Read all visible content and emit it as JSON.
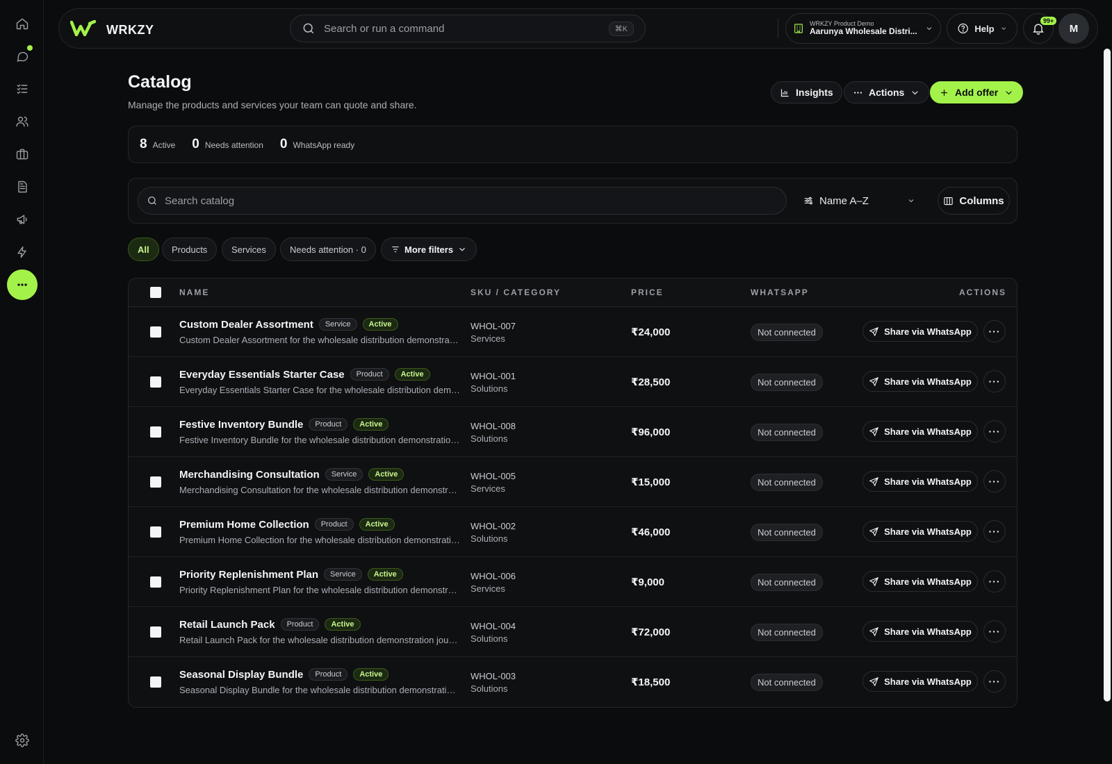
{
  "app": {
    "name": "WRKZY"
  },
  "command_search": {
    "placeholder": "Search or run a command",
    "shortcut": "⌘K"
  },
  "workspace": {
    "label": "WRKZY Product Demo",
    "name": "Aarunya Wholesale Distri..."
  },
  "help": {
    "label": "Help"
  },
  "notifications": {
    "count": "99+"
  },
  "user": {
    "initial": "M"
  },
  "page": {
    "title": "Catalog",
    "subtitle": "Manage the products and services your team can quote and share."
  },
  "header_actions": {
    "insights": "Insights",
    "actions": "Actions",
    "add_offer": "Add offer"
  },
  "stats": [
    {
      "value": "8",
      "label": "Active"
    },
    {
      "value": "0",
      "label": "Needs attention"
    },
    {
      "value": "0",
      "label": "WhatsApp ready"
    }
  ],
  "search_catalog": {
    "placeholder": "Search catalog"
  },
  "sort": {
    "label": "Name A–Z"
  },
  "columns_button": {
    "label": "Columns"
  },
  "filters": {
    "all": "All",
    "products": "Products",
    "services": "Services",
    "needs_attention": "Needs attention · 0",
    "more": "More filters"
  },
  "table": {
    "headers": {
      "name": "NAME",
      "sku": "SKU / CATEGORY",
      "price": "PRICE",
      "whatsapp": "WHATSAPP",
      "actions": "ACTIONS"
    },
    "share_label": "Share via WhatsApp",
    "more_label": "···",
    "rows": [
      {
        "name": "Custom Dealer Assortment",
        "type": "Service",
        "status": "Active",
        "desc": "Custom Dealer Assortment for the wholesale distribution demonstration journey.",
        "sku": "WHOL-007",
        "category": "Services",
        "price": "₹24,000",
        "whatsapp": "Not connected"
      },
      {
        "name": "Everyday Essentials Starter Case",
        "type": "Product",
        "status": "Active",
        "desc": "Everyday Essentials Starter Case for the wholesale distribution demonstration journey.",
        "sku": "WHOL-001",
        "category": "Solutions",
        "price": "₹28,500",
        "whatsapp": "Not connected"
      },
      {
        "name": "Festive Inventory Bundle",
        "type": "Product",
        "status": "Active",
        "desc": "Festive Inventory Bundle for the wholesale distribution demonstration journey.",
        "sku": "WHOL-008",
        "category": "Solutions",
        "price": "₹96,000",
        "whatsapp": "Not connected"
      },
      {
        "name": "Merchandising Consultation",
        "type": "Service",
        "status": "Active",
        "desc": "Merchandising Consultation for the wholesale distribution demonstration journey.",
        "sku": "WHOL-005",
        "category": "Services",
        "price": "₹15,000",
        "whatsapp": "Not connected"
      },
      {
        "name": "Premium Home Collection",
        "type": "Product",
        "status": "Active",
        "desc": "Premium Home Collection for the wholesale distribution demonstration journey.",
        "sku": "WHOL-002",
        "category": "Solutions",
        "price": "₹46,000",
        "whatsapp": "Not connected"
      },
      {
        "name": "Priority Replenishment Plan",
        "type": "Service",
        "status": "Active",
        "desc": "Priority Replenishment Plan for the wholesale distribution demonstration journey.",
        "sku": "WHOL-006",
        "category": "Services",
        "price": "₹9,000",
        "whatsapp": "Not connected"
      },
      {
        "name": "Retail Launch Pack",
        "type": "Product",
        "status": "Active",
        "desc": "Retail Launch Pack for the wholesale distribution demonstration journey.",
        "sku": "WHOL-004",
        "category": "Solutions",
        "price": "₹72,000",
        "whatsapp": "Not connected"
      },
      {
        "name": "Seasonal Display Bundle",
        "type": "Product",
        "status": "Active",
        "desc": "Seasonal Display Bundle for the wholesale distribution demonstration journey.",
        "sku": "WHOL-003",
        "category": "Solutions",
        "price": "₹18,500",
        "whatsapp": "Not connected"
      }
    ]
  },
  "colors": {
    "accent": "#a3f24a",
    "background": "#0b0c0d",
    "surface": "#0f1012"
  }
}
